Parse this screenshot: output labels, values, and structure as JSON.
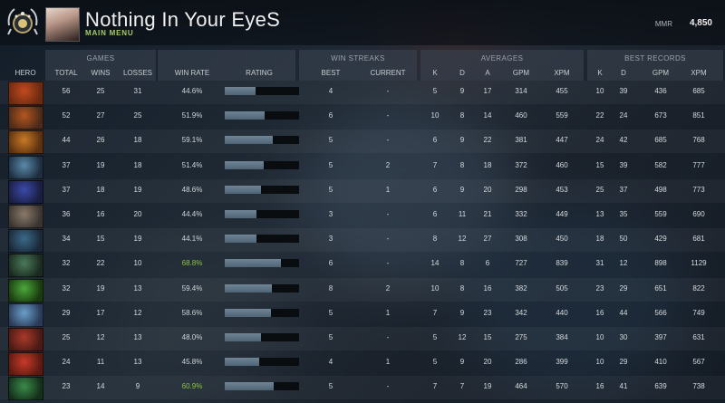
{
  "player": {
    "name": "Nothing In Your EyeS",
    "subtitle": "Main Menu"
  },
  "mmr": {
    "label": "MMR",
    "value": "4,850"
  },
  "groups": {
    "games": "Games",
    "win_streaks": "Win Streaks",
    "averages": "Averages",
    "best_records": "Best Records"
  },
  "columns": {
    "hero": "Hero",
    "total": "Total",
    "wins": "Wins",
    "losses": "Losses",
    "win_rate": "Win Rate",
    "rating": "Rating",
    "best": "Best",
    "current": "Current",
    "avg_k": "K",
    "avg_d": "D",
    "avg_a": "A",
    "avg_gpm": "GPM",
    "avg_xpm": "XPM",
    "best_k": "K",
    "best_d": "D",
    "best_gpm": "GPM",
    "best_xpm": "XPM"
  },
  "colors": {
    "win_rate_high": "#8cc63f",
    "win_rate_normal": "#d0d4d8"
  },
  "rows": [
    {
      "hero_icon": "hero-icon-1",
      "total": "56",
      "wins": "25",
      "losses": "31",
      "win_rate": "44.6%",
      "rating": 0.42,
      "high": false,
      "best": "4",
      "current": "-",
      "k": "5",
      "d": "9",
      "a": "17",
      "gpm": "314",
      "xpm": "455",
      "bk": "10",
      "bd": "39",
      "bgpm": "436",
      "bxpm": "685"
    },
    {
      "hero_icon": "hero-icon-2",
      "total": "52",
      "wins": "27",
      "losses": "25",
      "win_rate": "51.9%",
      "rating": 0.54,
      "high": false,
      "best": "6",
      "current": "-",
      "k": "10",
      "d": "8",
      "a": "14",
      "gpm": "460",
      "xpm": "559",
      "bk": "22",
      "bd": "24",
      "bgpm": "673",
      "bxpm": "851"
    },
    {
      "hero_icon": "hero-icon-3",
      "total": "44",
      "wins": "26",
      "losses": "18",
      "win_rate": "59.1%",
      "rating": 0.65,
      "high": false,
      "best": "5",
      "current": "-",
      "k": "6",
      "d": "9",
      "a": "22",
      "gpm": "381",
      "xpm": "447",
      "bk": "24",
      "bd": "42",
      "bgpm": "685",
      "bxpm": "768"
    },
    {
      "hero_icon": "hero-icon-4",
      "total": "37",
      "wins": "19",
      "losses": "18",
      "win_rate": "51.4%",
      "rating": 0.53,
      "high": false,
      "best": "5",
      "current": "2",
      "k": "7",
      "d": "8",
      "a": "18",
      "gpm": "372",
      "xpm": "460",
      "bk": "15",
      "bd": "39",
      "bgpm": "582",
      "bxpm": "777"
    },
    {
      "hero_icon": "hero-icon-5",
      "total": "37",
      "wins": "18",
      "losses": "19",
      "win_rate": "48.6%",
      "rating": 0.49,
      "high": false,
      "best": "5",
      "current": "1",
      "k": "6",
      "d": "9",
      "a": "20",
      "gpm": "298",
      "xpm": "453",
      "bk": "25",
      "bd": "37",
      "bgpm": "498",
      "bxpm": "773"
    },
    {
      "hero_icon": "hero-icon-6",
      "total": "36",
      "wins": "16",
      "losses": "20",
      "win_rate": "44.4%",
      "rating": 0.43,
      "high": false,
      "best": "3",
      "current": "-",
      "k": "6",
      "d": "11",
      "a": "21",
      "gpm": "332",
      "xpm": "449",
      "bk": "13",
      "bd": "35",
      "bgpm": "559",
      "bxpm": "690"
    },
    {
      "hero_icon": "hero-icon-7",
      "total": "34",
      "wins": "15",
      "losses": "19",
      "win_rate": "44.1%",
      "rating": 0.43,
      "high": false,
      "best": "3",
      "current": "-",
      "k": "8",
      "d": "12",
      "a": "27",
      "gpm": "308",
      "xpm": "450",
      "bk": "18",
      "bd": "50",
      "bgpm": "429",
      "bxpm": "681"
    },
    {
      "hero_icon": "hero-icon-8",
      "total": "32",
      "wins": "22",
      "losses": "10",
      "win_rate": "68.8%",
      "rating": 0.76,
      "high": true,
      "best": "6",
      "current": "-",
      "k": "14",
      "d": "8",
      "a": "6",
      "gpm": "727",
      "xpm": "839",
      "bk": "31",
      "bd": "12",
      "bgpm": "898",
      "bxpm": "1129"
    },
    {
      "hero_icon": "hero-icon-9",
      "total": "32",
      "wins": "19",
      "losses": "13",
      "win_rate": "59.4%",
      "rating": 0.64,
      "high": false,
      "best": "8",
      "current": "2",
      "k": "10",
      "d": "8",
      "a": "16",
      "gpm": "382",
      "xpm": "505",
      "bk": "23",
      "bd": "29",
      "bgpm": "651",
      "bxpm": "822"
    },
    {
      "hero_icon": "hero-icon-10",
      "total": "29",
      "wins": "17",
      "losses": "12",
      "win_rate": "58.6%",
      "rating": 0.62,
      "high": false,
      "best": "5",
      "current": "1",
      "k": "7",
      "d": "9",
      "a": "23",
      "gpm": "342",
      "xpm": "440",
      "bk": "16",
      "bd": "44",
      "bgpm": "566",
      "bxpm": "749"
    },
    {
      "hero_icon": "hero-icon-11",
      "total": "25",
      "wins": "12",
      "losses": "13",
      "win_rate": "48.0%",
      "rating": 0.49,
      "high": false,
      "best": "5",
      "current": "-",
      "k": "5",
      "d": "12",
      "a": "15",
      "gpm": "275",
      "xpm": "384",
      "bk": "10",
      "bd": "30",
      "bgpm": "397",
      "bxpm": "631"
    },
    {
      "hero_icon": "hero-icon-12",
      "total": "24",
      "wins": "11",
      "losses": "13",
      "win_rate": "45.8%",
      "rating": 0.46,
      "high": false,
      "best": "4",
      "current": "1",
      "k": "5",
      "d": "9",
      "a": "20",
      "gpm": "286",
      "xpm": "399",
      "bk": "10",
      "bd": "29",
      "bgpm": "410",
      "bxpm": "567"
    },
    {
      "hero_icon": "hero-icon-13",
      "total": "23",
      "wins": "14",
      "losses": "9",
      "win_rate": "60.9%",
      "rating": 0.66,
      "high": true,
      "best": "5",
      "current": "-",
      "k": "7",
      "d": "7",
      "a": "19",
      "gpm": "464",
      "xpm": "570",
      "bk": "16",
      "bd": "41",
      "bgpm": "639",
      "bxpm": "738"
    }
  ]
}
